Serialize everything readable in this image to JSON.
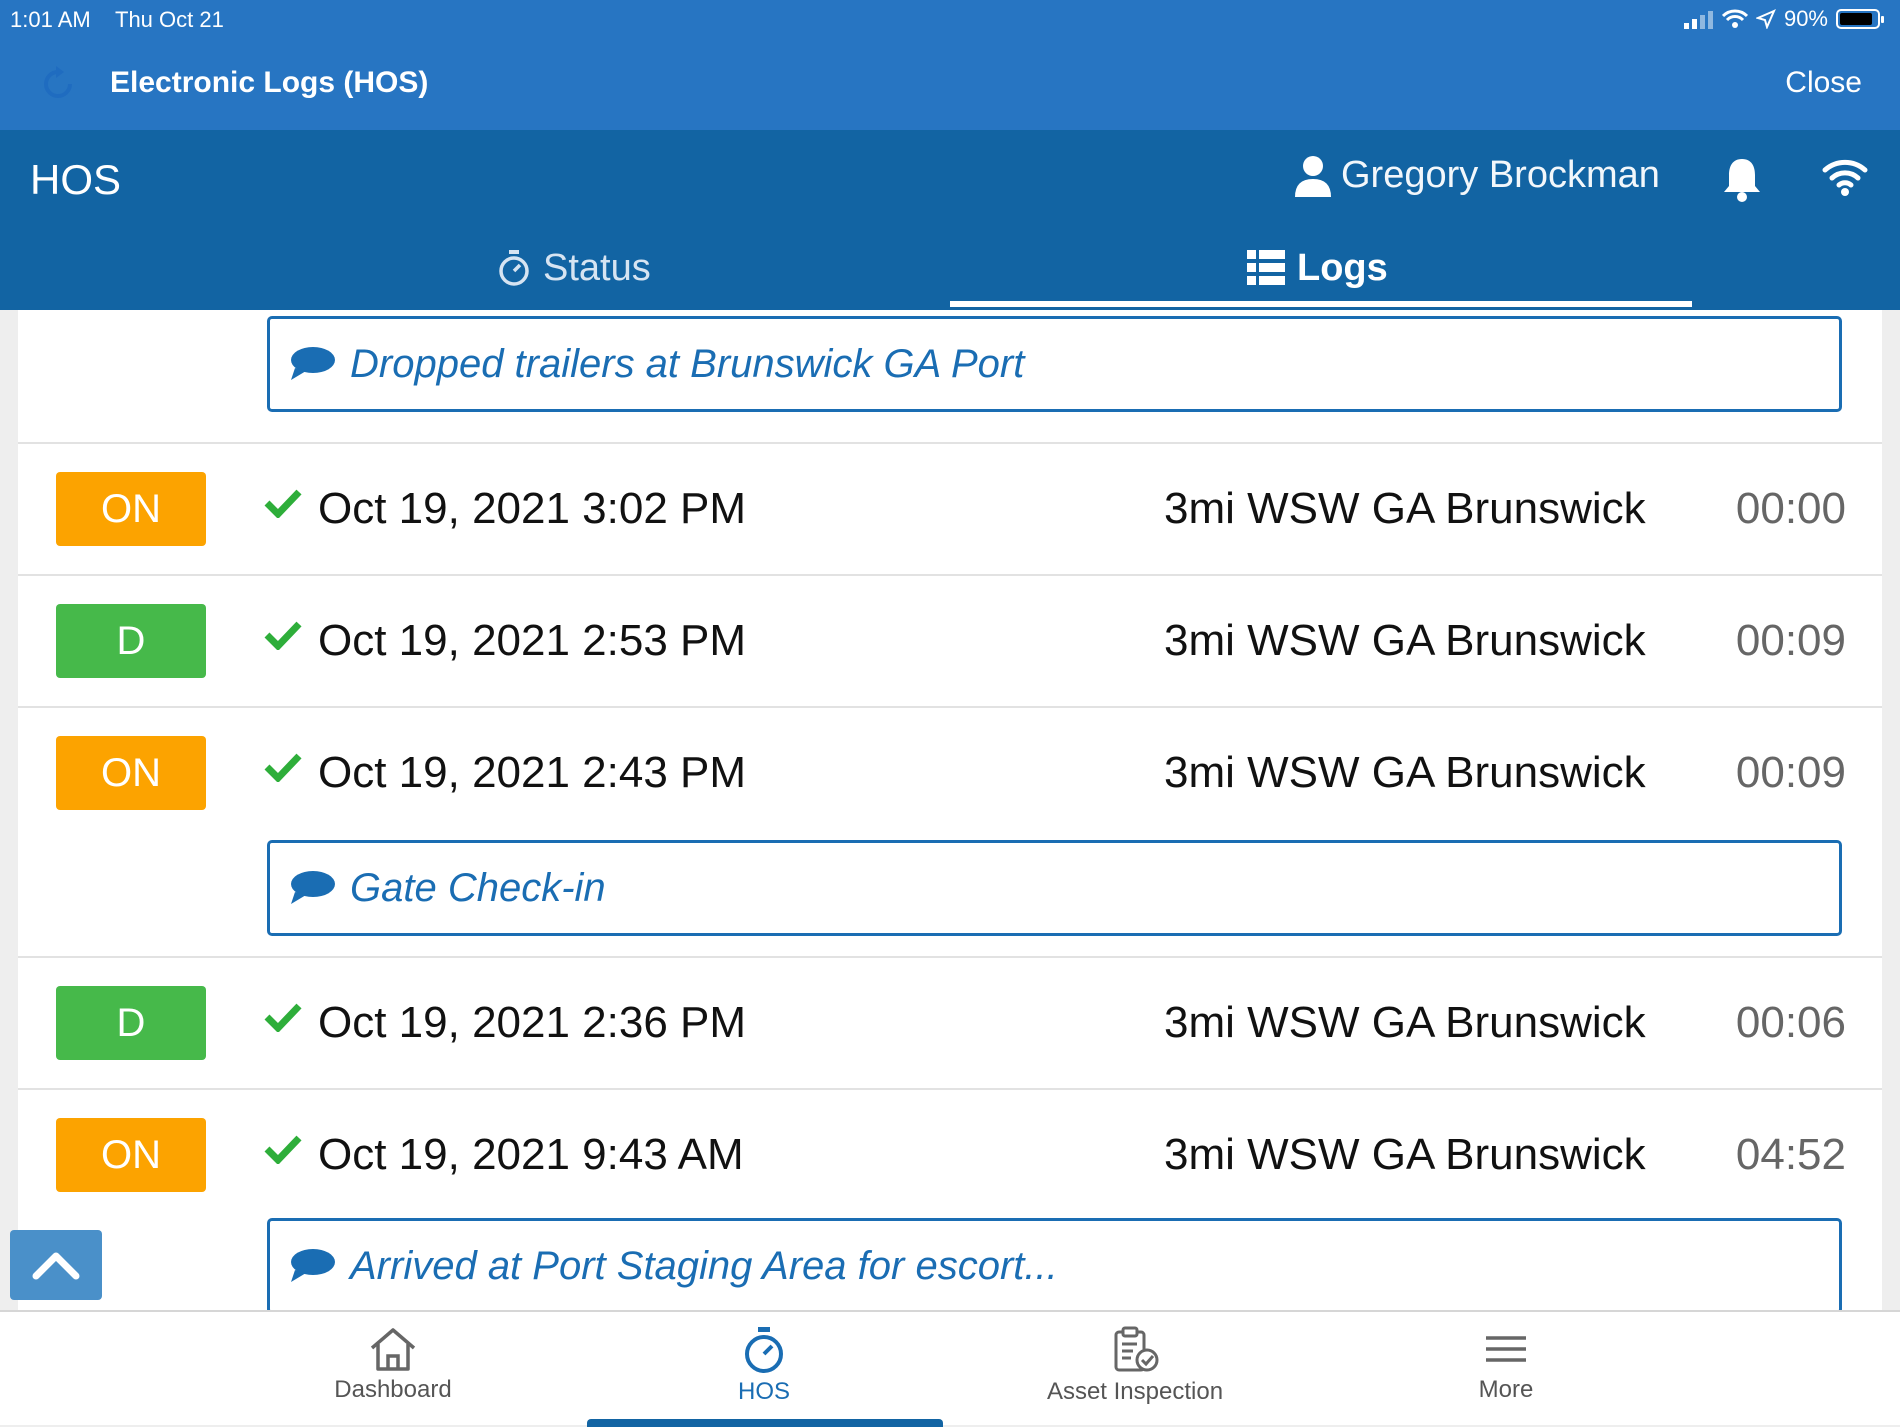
{
  "status_bar": {
    "time": "1:01 AM",
    "date": "Thu Oct 21",
    "battery": "90%"
  },
  "app_bar": {
    "title": "Electronic Logs (HOS)",
    "close_label": "Close"
  },
  "hos_header": {
    "title": "HOS",
    "user_name": "Gregory Brockman",
    "tabs": [
      {
        "label": "Status",
        "active": false
      },
      {
        "label": "Logs",
        "active": true
      }
    ]
  },
  "log_list": {
    "top_note": "Dropped trailers at Brunswick GA Port",
    "entries": [
      {
        "status": "ON",
        "datetime": "Oct 19, 2021 3:02 PM",
        "location": "3mi WSW GA Brunswick",
        "duration": "00:00",
        "note": ""
      },
      {
        "status": "D",
        "datetime": "Oct 19, 2021 2:53 PM",
        "location": "3mi WSW GA Brunswick",
        "duration": "00:09",
        "note": ""
      },
      {
        "status": "ON",
        "datetime": "Oct 19, 2021 2:43 PM",
        "location": "3mi WSW GA Brunswick",
        "duration": "00:09",
        "note": "Gate Check-in"
      },
      {
        "status": "D",
        "datetime": "Oct 19, 2021 2:36 PM",
        "location": "3mi WSW GA Brunswick",
        "duration": "00:06",
        "note": ""
      },
      {
        "status": "ON",
        "datetime": "Oct 19, 2021 9:43 AM",
        "location": "3mi WSW GA Brunswick",
        "duration": "04:52",
        "note": "Arrived at Port Staging Area for escort..."
      }
    ]
  },
  "bottom_nav": {
    "items": [
      {
        "label": "Dashboard",
        "icon": "home-icon",
        "active": false
      },
      {
        "label": "HOS",
        "icon": "stopwatch-icon",
        "active": true
      },
      {
        "label": "Asset Inspection",
        "icon": "clipboard-check-icon",
        "active": false
      },
      {
        "label": "More",
        "icon": "menu-icon",
        "active": false
      }
    ]
  },
  "colors": {
    "app_bar": "#2775c2",
    "header": "#1264a3",
    "status_on": "#fca300",
    "status_driving": "#46b94a",
    "note_accent": "#1a6db3",
    "check": "#2eae3a"
  }
}
